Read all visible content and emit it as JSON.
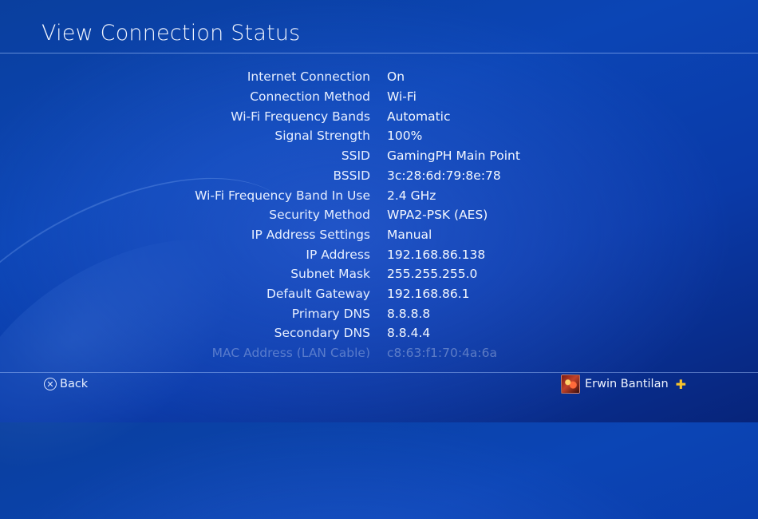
{
  "title": "View Connection Status",
  "rows": [
    {
      "label": "Internet Connection",
      "value": "On"
    },
    {
      "label": "Connection Method",
      "value": "Wi-Fi"
    },
    {
      "label": "Wi-Fi Frequency Bands",
      "value": "Automatic"
    },
    {
      "label": "Signal Strength",
      "value": "100%"
    },
    {
      "label": "SSID",
      "value": "GamingPH Main Point"
    },
    {
      "label": "BSSID",
      "value": "3c:28:6d:79:8e:78"
    },
    {
      "label": "Wi-Fi Frequency Band In Use",
      "value": "2.4 GHz"
    },
    {
      "label": "Security Method",
      "value": "WPA2-PSK (AES)"
    },
    {
      "label": "IP Address Settings",
      "value": "Manual"
    },
    {
      "label": "IP Address",
      "value": "192.168.86.138"
    },
    {
      "label": "Subnet Mask",
      "value": "255.255.255.0"
    },
    {
      "label": "Default Gateway",
      "value": "192.168.86.1"
    },
    {
      "label": "Primary DNS",
      "value": "8.8.8.8"
    },
    {
      "label": "Secondary DNS",
      "value": "8.8.4.4"
    },
    {
      "label": "MAC Address (LAN Cable)",
      "value": "c8:63:f1:70:4a:6a"
    }
  ],
  "footer": {
    "back_label": "Back",
    "back_icon": "cross-button-icon",
    "user_name": "Erwin Bantilan",
    "plus_icon": "playstation-plus-icon"
  },
  "colors": {
    "background": "#0b45b5",
    "plus": "#f7c32b"
  }
}
